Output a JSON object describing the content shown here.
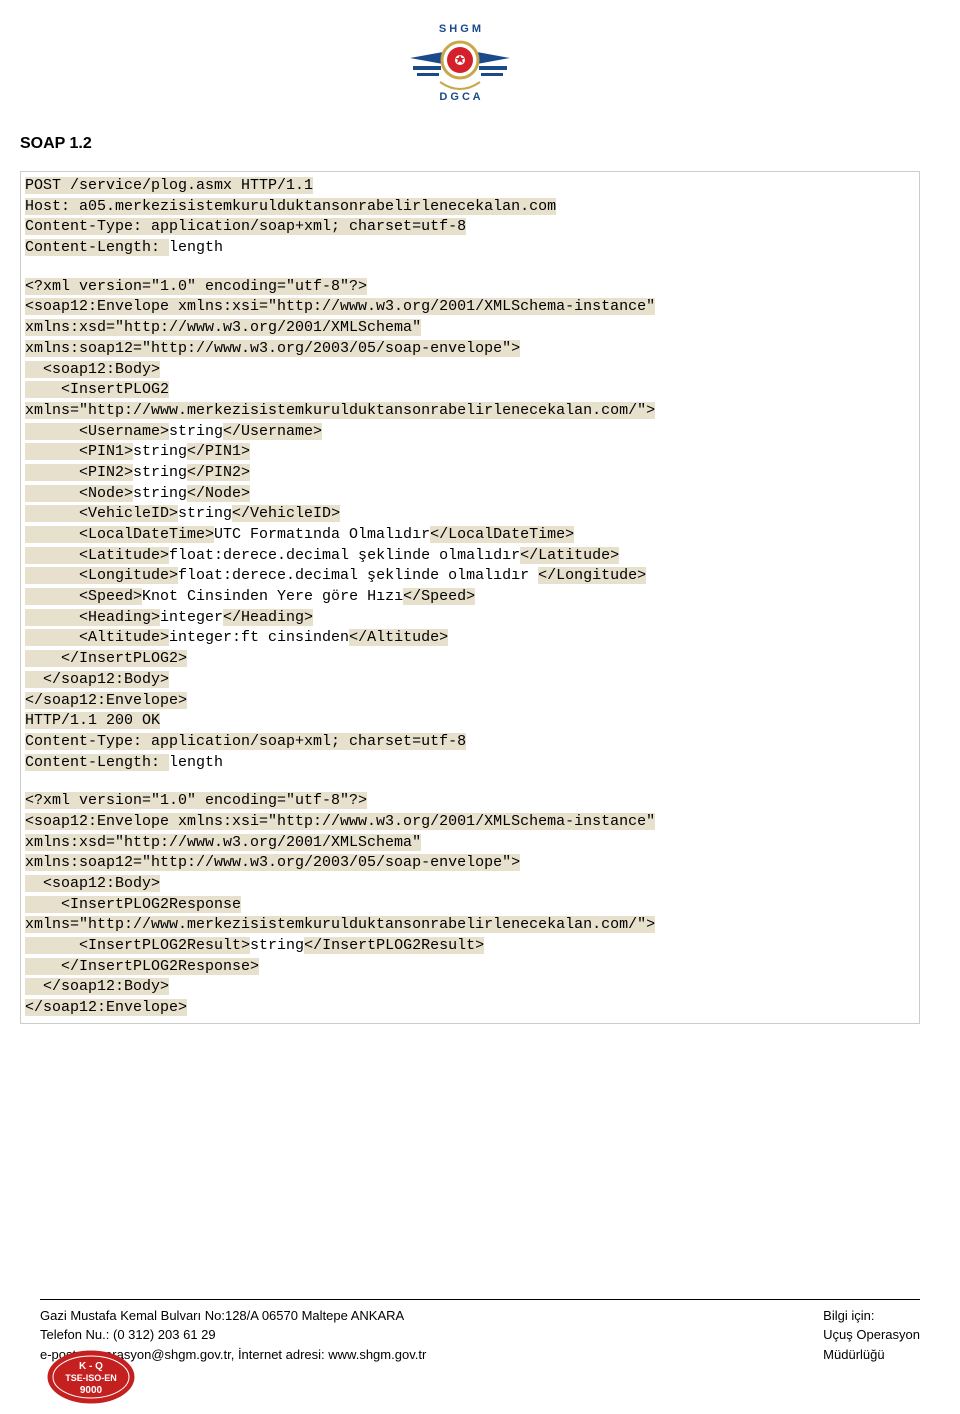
{
  "section_title": "SOAP 1.2",
  "code": {
    "l1": "POST /service/plog.asmx HTTP/1.1",
    "l2": "Host: a05.merkezisistemkurulduktansonrabelirlenecekalan.com",
    "l3": "Content-Type: application/soap+xml; charset=utf-8",
    "l4a": "Content-Length: ",
    "l4b": "length",
    "l5": "<?xml version=\"1.0\" encoding=\"utf-8\"?>",
    "l6": "<soap12:Envelope xmlns:xsi=\"http://www.w3.org/2001/XMLSchema-instance\"",
    "l7": "xmlns:xsd=\"http://www.w3.org/2001/XMLSchema\"",
    "l8": "xmlns:soap12=\"http://www.w3.org/2003/05/soap-envelope\">",
    "l9": "  <soap12:Body>",
    "l10": "    <InsertPLOG2",
    "l11": "xmlns=\"http://www.merkezisistemkurulduktansonrabelirlenecekalan.com/\">",
    "l12a": "      <Username>",
    "l12b": "string",
    "l12c": "</Username>",
    "l13a": "      <PIN1>",
    "l13b": "string",
    "l13c": "</PIN1>",
    "l14a": "      <PIN2>",
    "l14b": "string",
    "l14c": "</PIN2>",
    "l15a": "      <Node>",
    "l15b": "string",
    "l15c": "</Node>",
    "l16a": "      <VehicleID>",
    "l16b": "string",
    "l16c": "</VehicleID>",
    "l17a": "      <LocalDateTime>",
    "l17b": "UTC Formatında Olmalıdır",
    "l17c": "</LocalDateTime>",
    "l18a": "      <Latitude>",
    "l18b": "float:derece.decimal şeklinde olmalıdır",
    "l18c": "</Latitude>",
    "l19a": "      <Longitude>",
    "l19b": "float:derece.decimal şeklinde olmalıdır ",
    "l19c": "</Longitude>",
    "l20a": "      <Speed>",
    "l20b": "Knot Cinsinden Yere göre Hızı",
    "l20c": "</Speed>",
    "l21a": "      <Heading>",
    "l21b": "integer",
    "l21c": "</Heading>",
    "l22a": "      <Altitude>",
    "l22b": "integer:ft cinsinden",
    "l22c": "</Altitude>",
    "l23": "    </InsertPLOG2>",
    "l24": "  </soap12:Body>",
    "l25": "</soap12:Envelope>",
    "l26": "HTTP/1.1 200 OK",
    "l27": "Content-Type: application/soap+xml; charset=utf-8",
    "l28a": "Content-Length: ",
    "l28b": "length",
    "l29": "<?xml version=\"1.0\" encoding=\"utf-8\"?>",
    "l30": "<soap12:Envelope xmlns:xsi=\"http://www.w3.org/2001/XMLSchema-instance\"",
    "l31": "xmlns:xsd=\"http://www.w3.org/2001/XMLSchema\"",
    "l32": "xmlns:soap12=\"http://www.w3.org/2003/05/soap-envelope\">",
    "l33": "  <soap12:Body>",
    "l34": "    <InsertPLOG2Response",
    "l35": "xmlns=\"http://www.merkezisistemkurulduktansonrabelirlenecekalan.com/\">",
    "l36a": "      <InsertPLOG2Result>",
    "l36b": "string",
    "l36c": "</InsertPLOG2Result>",
    "l37": "    </InsertPLOG2Response>",
    "l38": "  </soap12:Body>",
    "l39": "</soap12:Envelope>"
  },
  "footer": {
    "addr1": "Gazi Mustafa Kemal Bulvarı No:128/A 06570 Maltepe ANKARA",
    "addr2": "Telefon Nu.: (0 312) 203 61 29",
    "addr3": "e-posta: operasyon@shgm.gov.tr,  İnternet adresi: www.shgm.gov.tr",
    "info1": "Bilgi için:",
    "info2": "Uçuş Operasyon",
    "info3": "Müdürlüğü"
  },
  "cert_label": "K - Q\nTSE-ISO-EN\n9000"
}
